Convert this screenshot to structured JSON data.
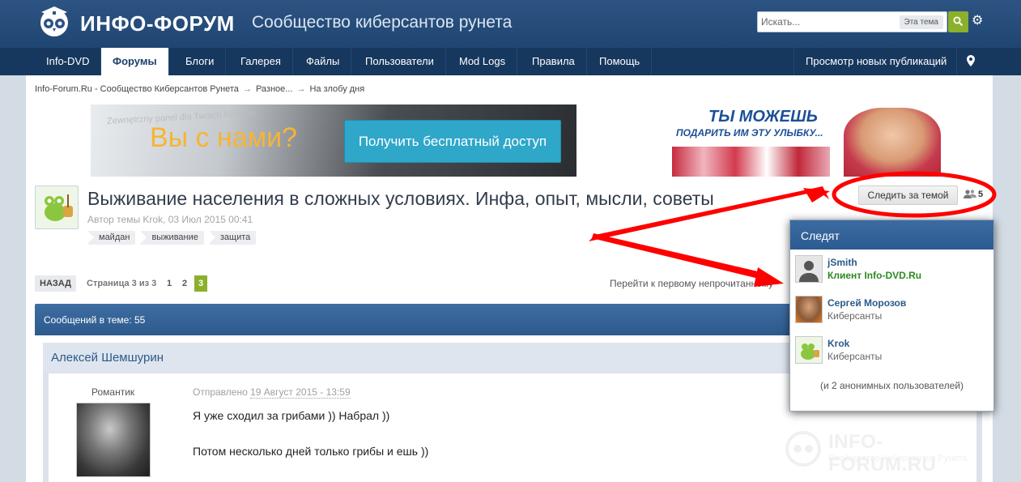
{
  "header": {
    "logo": "ИНФО-ФОРУМ",
    "tagline": "Сообщество киберсантов рунета",
    "search_placeholder": "Искать...",
    "search_scope": "Эта тема"
  },
  "nav": {
    "items": [
      "Info-DVD",
      "Форумы",
      "Блоги",
      "Галерея",
      "Файлы",
      "Пользователи",
      "Mod Logs",
      "Правила",
      "Помощь"
    ],
    "active_index": 1,
    "right": "Просмотр новых публикаций"
  },
  "breadcrumb": [
    "Info-Forum.Ru - Сообщество Киберсантов Рунета",
    "Разное...",
    "На злобу дня"
  ],
  "breadcrumb_sep": "→",
  "banner_left": {
    "small_text": "Zewnętrzny panel dla Twoich klientów",
    "title": "Вы с нами?",
    "button": "Получить бесплатный доступ"
  },
  "banner_right": {
    "line1": "ТЫ МОЖЕШЬ",
    "line2": "ПОДАРИТЬ ИМ ЭТУ УЛЫБКУ..."
  },
  "topic": {
    "title": "Выживание населения в сложных условиях. Инфа, опыт, мысли, советы",
    "meta": "Автор темы Krok, 03 Июл 2015 00:41",
    "tags": [
      "майдан",
      "выживание",
      "защита"
    ],
    "follow_button": "Следить за темой",
    "follow_count": "5"
  },
  "pager": {
    "back": "НАЗАД",
    "info": "Страница 3 из 3",
    "pages": [
      "1",
      "2",
      "3"
    ],
    "active": "3",
    "first_unread": "Перейти к первому непрочитанному"
  },
  "posts_bar": "Сообщений в теме: 55",
  "post": {
    "author": "Алексей Шемшурин",
    "rank": "Романтик",
    "sent_label": "Отправлено",
    "sent_date": "19 Август 2015 - 13:59",
    "line1": "Я уже сходил за грибами )) Набрал ))",
    "line2": "Потом несколько дней только грибы и ешь ))"
  },
  "watermark": {
    "title": "INFO-FORUM.RU",
    "subtitle": "Сообщество Киберсантов Рунета"
  },
  "popup": {
    "title": "Следят",
    "followers": [
      {
        "name": "jSmith",
        "group": "Клиент Info-DVD.Ru",
        "highlight": true
      },
      {
        "name": "Сергей Морозов",
        "group": "Киберсанты",
        "highlight": false
      },
      {
        "name": "Krok",
        "group": "Киберсанты",
        "highlight": false
      }
    ],
    "anon": "(и 2 анонимных пользователей)"
  },
  "colors": {
    "header": "#2d5383",
    "nav": "#17385e",
    "accent_green": "#8bb02c",
    "annotation_red": "#ff0000"
  }
}
